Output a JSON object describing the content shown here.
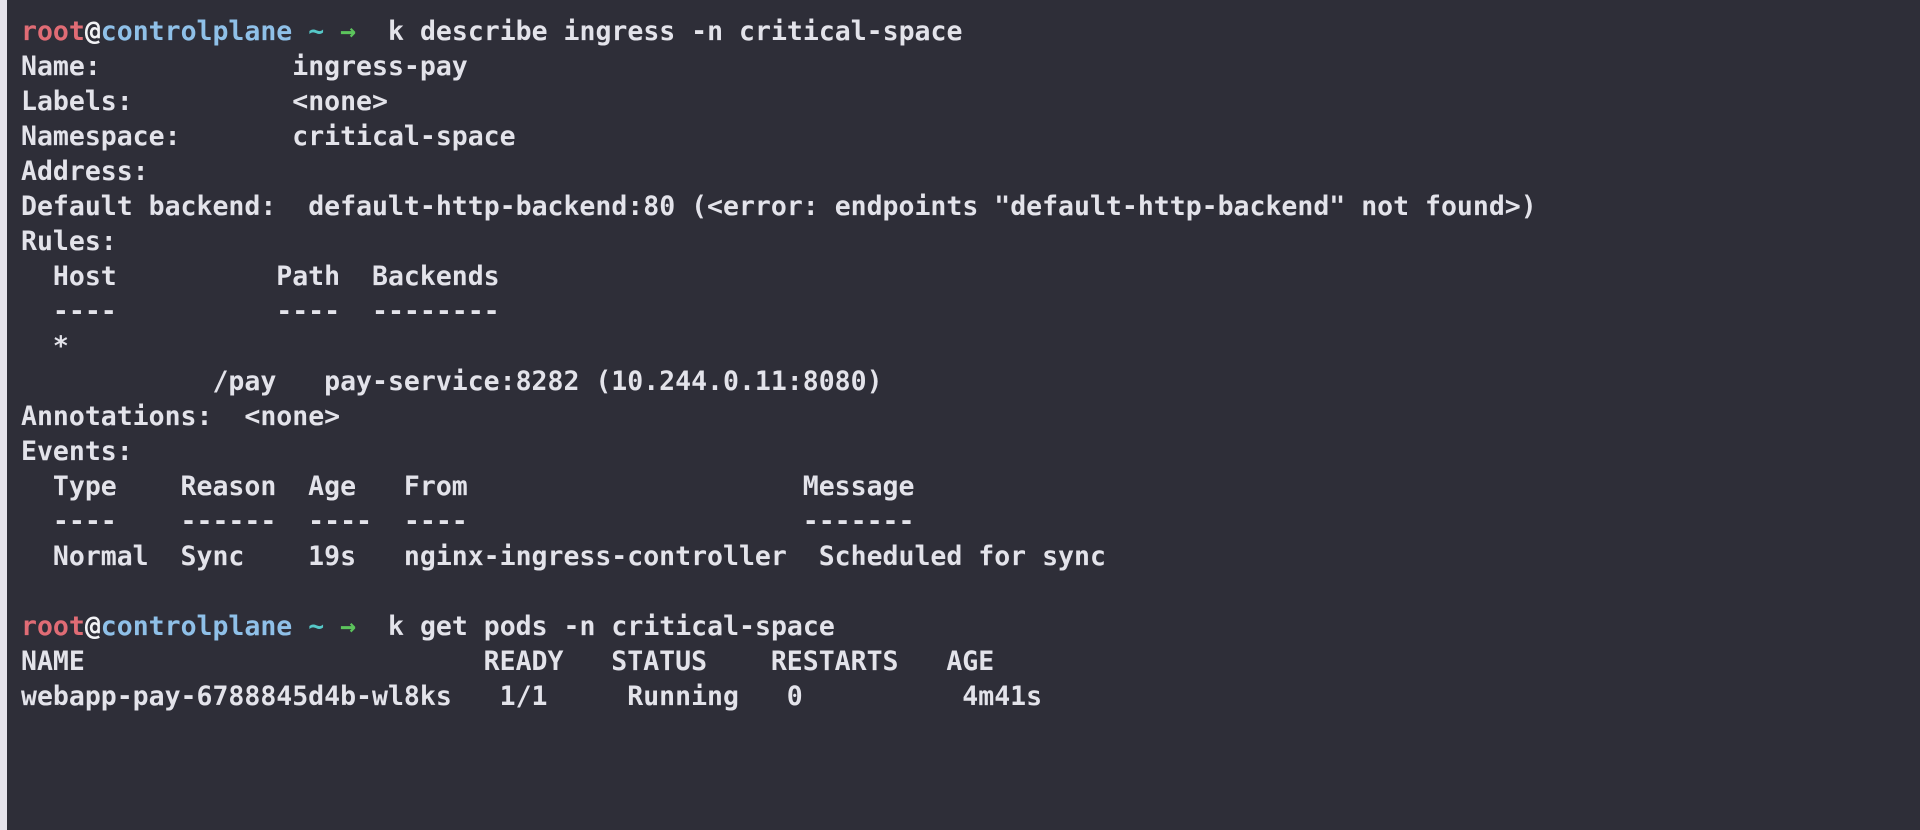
{
  "terminal": {
    "theme": {
      "background": "#2e2e38",
      "foreground": "#e3e3ea",
      "gutter": "#e6e4ec",
      "prompt_user_color": "#e06c75",
      "prompt_host_color": "#8fc0e8",
      "prompt_path_color": "#56c8c8",
      "prompt_arrow_color": "#5cc45c"
    },
    "prompt": {
      "user": "root",
      "at": "@",
      "host": "controlplane",
      "path": "~",
      "arrow": "→"
    },
    "commands": [
      {
        "text": "k describe ingress -n critical-space"
      },
      {
        "text": "k get pods -n critical-space"
      }
    ],
    "describe_output": {
      "fields": [
        {
          "label": "Name:",
          "pad": "            ",
          "value": "ingress-pay"
        },
        {
          "label": "Labels:",
          "pad": "          ",
          "value": "<none>"
        },
        {
          "label": "Namespace:",
          "pad": "       ",
          "value": "critical-space"
        },
        {
          "label": "Address:",
          "pad": "",
          "value": ""
        },
        {
          "label": "Default backend:",
          "pad": "  ",
          "value": "default-http-backend:80 (<error: endpoints \"default-http-backend\" not found>)"
        }
      ],
      "rules_header": "Rules:",
      "rules_table": {
        "columns": [
          "Host",
          "Path",
          "Backends"
        ],
        "header_line": "  Host          Path  Backends",
        "divider_line": "  ----          ----  --------",
        "rows": [
          "  *",
          "            /pay   pay-service:8282 (10.244.0.11:8080)"
        ]
      },
      "annotations_label": "Annotations:",
      "annotations_value": "<none>",
      "events_header": "Events:",
      "events_table": {
        "columns": [
          "Type",
          "Reason",
          "Age",
          "From",
          "Message"
        ],
        "header_line": "  Type    Reason  Age   From                     Message",
        "divider_line": "  ----    ------  ----  ----                     -------",
        "rows": [
          {
            "type": "Normal",
            "reason": "Sync",
            "age": "19s",
            "from": "nginx-ingress-controller",
            "message": "Scheduled for sync",
            "line": "  Normal  Sync    19s   nginx-ingress-controller  Scheduled for sync"
          }
        ]
      }
    },
    "pods_output": {
      "columns": [
        "NAME",
        "READY",
        "STATUS",
        "RESTARTS",
        "AGE"
      ],
      "header_line": "NAME                         READY   STATUS    RESTARTS   AGE",
      "rows": [
        {
          "name": "webapp-pay-6788845d4b-wl8ks",
          "ready": "1/1",
          "status": "Running",
          "restarts": "0",
          "age": "4m41s",
          "line": "webapp-pay-6788845d4b-wl8ks   1/1     Running   0          4m41s"
        }
      ]
    }
  }
}
